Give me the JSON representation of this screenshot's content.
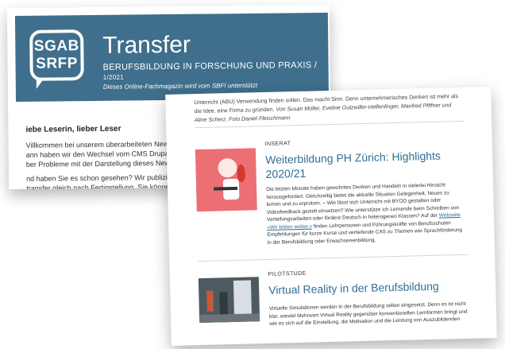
{
  "back_page": {
    "logo_line1": "SGAB",
    "logo_line2": "SRFP",
    "title": "Transfer",
    "subtitle": "BERUFSBILDUNG IN FORSCHUNG UND PRAXIS /",
    "issue": "1/2021",
    "tagline": "Dieses Online-Fachmagazin wird vom SBFI unterstützt",
    "greeting": "iebe Leserin, lieber Leser",
    "lines": [
      "Villkommen bei unserem überarbeiteten Newslette",
      "ann haben wir den Wechsel vom CMS Drupal auf",
      "ber Probleme mit der Darstellung dieses Newslett",
      "nd haben Sie es schon gesehen? Wir publizieren",
      "transfer gleich nach Fertigstellung. Sie können die"
    ]
  },
  "front_page": {
    "top_line1": "Unterricht (ABU) Verwendung finden sollen. Das macht Sinn. Denn unternehmerisches",
    "top_line2": "Denken ist mehr als die Idee, eine Firma zu gründen.",
    "top_authors": "Von Susan Müller, Eveline Gutzwiller-Helfenfinger, Manfred Pfiffner und Aline Scherz, Foto Daniel Fleischmann",
    "article1": {
      "category": "INSERAT",
      "headline": "Weiterbildung PH Zürich: Highlights 2020/21",
      "body_pre": "Die letzten Monate haben gewohntes Denken und Handeln in vielerlei Hinsicht herausgefordert. Gleichzeitig bietet die aktuelle Situation Gelegenheit, Neues zu lernen und zu erproben. – Wie lässt sich Unterricht mit BYOD gestalten oder Videofeedback gezielt einsetzen? Wie unterstütze ich Lernende beim Schreiben von Vertiefungsarbeiten oder fördere Deutsch in heterogenen Klassen? Auf der ",
      "link_text": "Webseite «Wir bilden weiter.»",
      "body_post": " finden Lehrpersonen und Führungskräfte von Berufsschulen Empfehlungen für kurze Kurse und vertiefende CAS zu Themen wie Sprachförderung in der Berufsbildung oder Erwachsenenbildung."
    },
    "article2": {
      "category": "PILOTSTUDE",
      "headline": "Virtual Reality in der Berufsbildung",
      "body": "Virtuelle Simulationen werden in der Berufsbildung selten eingesetzt. Denn es ist nicht klar, wieviel Mehrwert Virtual Reality gegenüber konventionellen Lernformen bringt und wie es sich auf die Einstellung, die Motivation und die Leistung von Auszubildenden"
    }
  },
  "colors": {
    "header_bg": "#3f6f8c",
    "link_blue": "#2f6e95",
    "thumb_pink": "#ec6f73"
  }
}
